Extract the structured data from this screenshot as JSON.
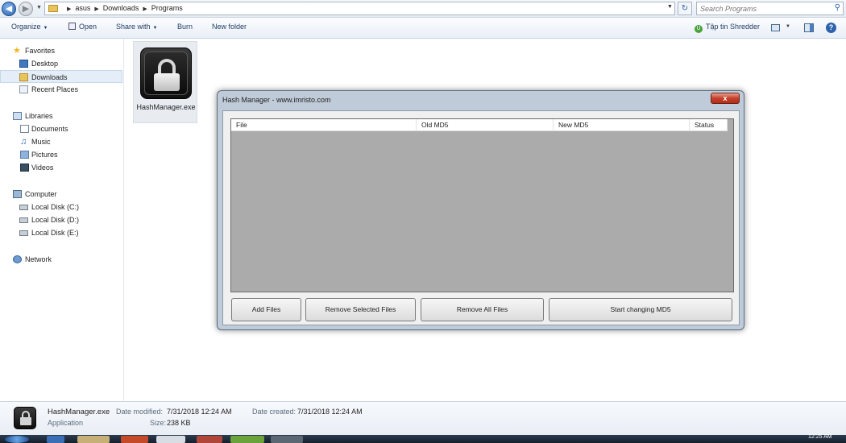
{
  "explorer": {
    "breadcrumb": [
      "asus",
      "Downloads",
      "Programs"
    ],
    "search_placeholder": "Search Programs",
    "toolbar": {
      "organize": "Organize",
      "open": "Open",
      "share_with": "Share with",
      "burn": "Burn",
      "new_folder": "New folder",
      "shredder": "Tập tin Shredder"
    },
    "nav": {
      "favorites": "Favorites",
      "desktop": "Desktop",
      "downloads": "Downloads",
      "recent_places": "Recent Places",
      "libraries": "Libraries",
      "documents": "Documents",
      "music": "Music",
      "pictures": "Pictures",
      "videos": "Videos",
      "computer": "Computer",
      "disk_c": "Local Disk (C:)",
      "disk_d": "Local Disk (D:)",
      "disk_e": "Local Disk (E:)",
      "network": "Network"
    },
    "file": {
      "name": "HashManager.exe"
    }
  },
  "hash_manager": {
    "title": "Hash Manager - www.imristo.com",
    "close": "x",
    "columns": [
      "File",
      "Old MD5",
      "New MD5",
      "Status"
    ],
    "buttons": {
      "add_files": "Add Files",
      "remove_selected": "Remove Selected Files",
      "remove_all": "Remove All Files",
      "start": "Start changing MD5"
    }
  },
  "details": {
    "name": "HashManager.exe",
    "type": "Application",
    "date_modified_label": "Date modified:",
    "date_modified": "7/31/2018 12:24 AM",
    "size_label": "Size:",
    "size": "238 KB",
    "date_created_label": "Date created:",
    "date_created": "7/31/2018 12:24 AM"
  },
  "taskbar": {
    "clock": "12:25 AM"
  },
  "colors": {
    "accent": "#2d62ad",
    "close_red": "#c4402a",
    "listview_bg": "#ababab"
  }
}
